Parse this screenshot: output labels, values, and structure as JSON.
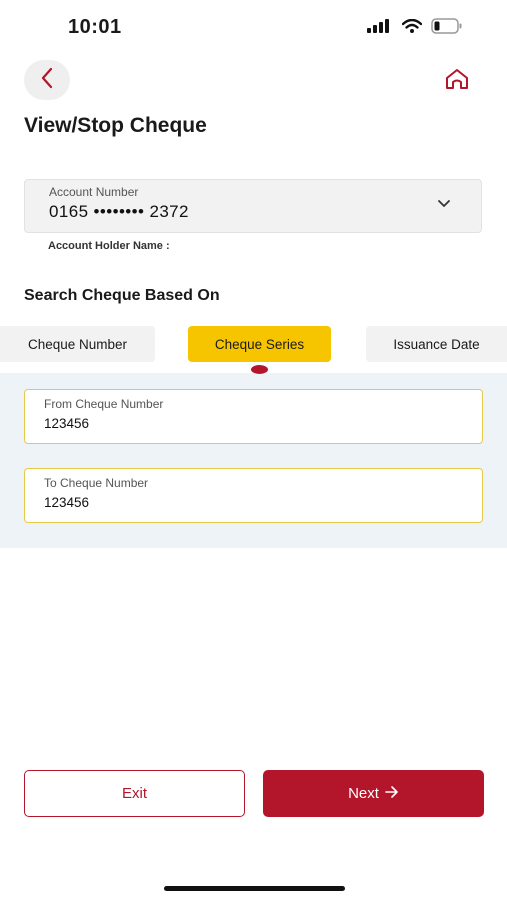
{
  "status_bar": {
    "time": "10:01"
  },
  "header": {
    "title": "View/Stop Cheque"
  },
  "account": {
    "label": "Account Number",
    "value": "0165 •••••••• 2372",
    "holder_label": "Account Holder Name :"
  },
  "search": {
    "heading": "Search Cheque Based On",
    "tabs": [
      {
        "label": "Cheque Number",
        "selected": false
      },
      {
        "label": "Cheque Series",
        "selected": true
      },
      {
        "label": "Issuance Date",
        "selected": false
      }
    ]
  },
  "form": {
    "from": {
      "label": "From Cheque Number",
      "value": "123456"
    },
    "to": {
      "label": "To Cheque Number",
      "value": "123456"
    }
  },
  "actions": {
    "exit_label": "Exit",
    "next_label": "Next"
  },
  "colors": {
    "brand": "#b3152b",
    "accent": "#f7c500",
    "panel": "#eef3f8"
  }
}
